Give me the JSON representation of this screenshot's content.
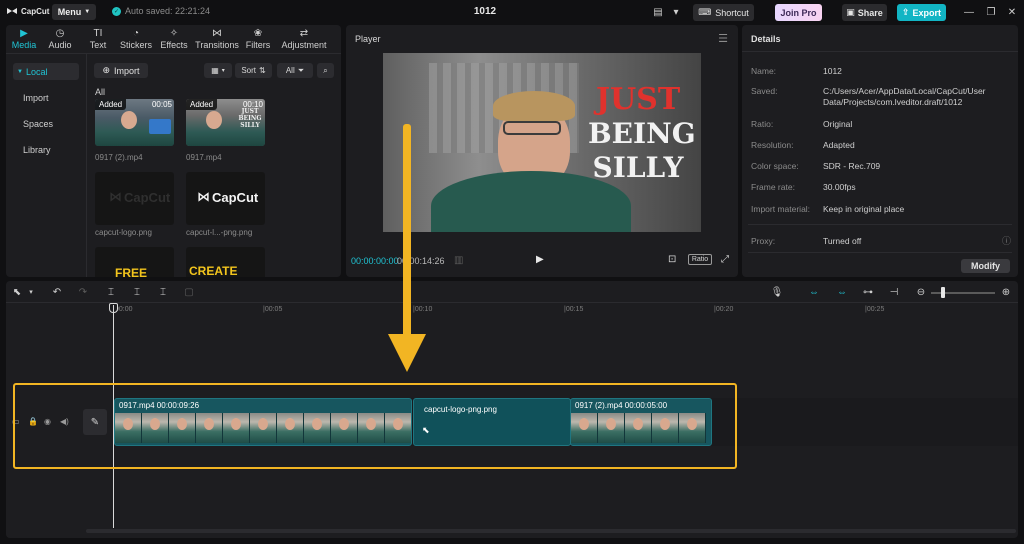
{
  "app": {
    "logo_text": "CapCut",
    "menu_label": "Menu",
    "autosave_text": "Auto saved: 22:21:24",
    "project_title": "1012",
    "shortcut_label": "Shortcut",
    "joinpro_label": "Join Pro",
    "share_label": "Share",
    "export_label": "Export"
  },
  "media": {
    "tabs": [
      {
        "label": "Media",
        "icon": "media-icon"
      },
      {
        "label": "Audio",
        "icon": "audio-icon"
      },
      {
        "label": "Text",
        "icon": "text-icon"
      },
      {
        "label": "Stickers",
        "icon": "stickers-icon"
      },
      {
        "label": "Effects",
        "icon": "effects-icon"
      },
      {
        "label": "Transitions",
        "icon": "transitions-icon"
      },
      {
        "label": "Filters",
        "icon": "filters-icon"
      },
      {
        "label": "Adjustment",
        "icon": "adjustment-icon"
      }
    ],
    "nav": [
      "Local",
      "Import",
      "Spaces",
      "Library"
    ],
    "import_label": "Import",
    "sort_label": "Sort",
    "all_filter_label": "All",
    "section_label": "All",
    "items": [
      {
        "name": "0917 (2).mp4",
        "badge": "Added",
        "duration": "00:05"
      },
      {
        "name": "0917.mp4",
        "badge": "Added",
        "duration": "00:10",
        "overlay_text": "JUST BEING SILLY"
      },
      {
        "name": "capcut-logo.png",
        "logo_text": "CapCut"
      },
      {
        "name": "capcut-l...-png.png",
        "logo_text": "CapCut"
      },
      {
        "name": "",
        "overlay_text": "FREE"
      },
      {
        "name": "",
        "overlay_text": "CREATE"
      }
    ]
  },
  "player": {
    "title": "Player",
    "overlay_line1": "JUST",
    "overlay_line2": "BEING",
    "overlay_line3": "SILLY",
    "timecode_current": "00:00:00:00",
    "timecode_total": "00:00:14:26",
    "ratio_label": "Ratio"
  },
  "details": {
    "title": "Details",
    "rows": [
      {
        "label": "Name:",
        "value": "1012"
      },
      {
        "label": "Saved:",
        "value": "C:/Users/Acer/AppData/Local/CapCut/User Data/Projects/com.lveditor.draft/1012"
      },
      {
        "label": "Ratio:",
        "value": "Original"
      },
      {
        "label": "Resolution:",
        "value": "Adapted"
      },
      {
        "label": "Color space:",
        "value": "SDR - Rec.709"
      },
      {
        "label": "Frame rate:",
        "value": "30.00fps"
      },
      {
        "label": "Import material:",
        "value": "Keep in original place"
      },
      {
        "label": "Proxy:",
        "value": "Turned off"
      }
    ],
    "modify_label": "Modify"
  },
  "timeline": {
    "ruler": [
      "00:00",
      "|00:05",
      "|00:10",
      "|00:15",
      "|00:20",
      "|00:25"
    ],
    "clips": [
      {
        "label": "0917.mp4  00:00:09:26",
        "kind": "video"
      },
      {
        "label": "capcut-logo-png.png",
        "kind": "image"
      },
      {
        "label": "0917 (2).mp4  00:00:05:00",
        "kind": "video"
      }
    ]
  },
  "colors": {
    "accent": "#20c4d4",
    "export": "#12b5c4",
    "clip_fill": "#17565f",
    "highlight": "#f2b523",
    "overlay_red": "#e0322d"
  }
}
